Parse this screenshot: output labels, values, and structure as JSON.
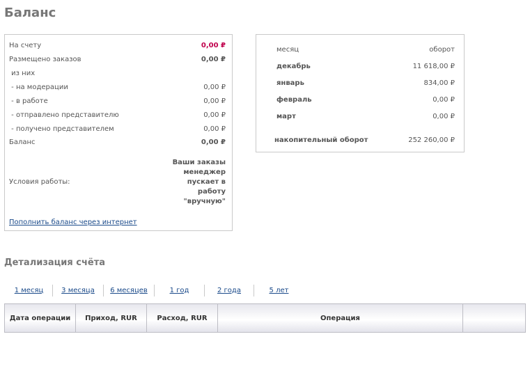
{
  "page": {
    "title": "Баланс"
  },
  "balance": {
    "rows": [
      {
        "label": "На счету",
        "value": "0,00 ₽"
      },
      {
        "label": "Размещено заказов",
        "value": "0,00 ₽"
      },
      {
        "label": " из них",
        "value": ""
      },
      {
        "label": " - на модерации",
        "value": "0,00 ₽"
      },
      {
        "label": " - в работе",
        "value": "0,00 ₽"
      },
      {
        "label": " - отправлено представителю",
        "value": "0,00 ₽"
      },
      {
        "label": " - получено представителем",
        "value": "0,00 ₽"
      },
      {
        "label": "Баланс",
        "value": "0,00 ₽"
      }
    ],
    "conditions_label": "Условия работы:",
    "conditions_value": "Ваши заказы менеджер пускает в работу \"вручную\"",
    "topup_link": "Пополнить баланс через интернет"
  },
  "turnover": {
    "header_month": "месяц",
    "header_turnover": "оборот",
    "months": [
      {
        "name": "декабрь",
        "value": "11 618,00 ₽"
      },
      {
        "name": "январь",
        "value": "834,00 ₽"
      },
      {
        "name": "февраль",
        "value": "0,00 ₽"
      },
      {
        "name": "март",
        "value": "0,00 ₽"
      }
    ],
    "cumulative_label": "накопительный оборот",
    "cumulative_value": "252 260,00 ₽"
  },
  "details": {
    "title": "Детализация счёта",
    "periods": [
      "1 месяц",
      "3 месяца",
      "6 месяцев",
      "1 год",
      "2 года",
      "5 лет"
    ],
    "columns": [
      "Дата операции",
      "Приход, RUR",
      "Расход, RUR",
      "Операция",
      ""
    ]
  },
  "colors": {
    "accent_red": "#c0004c",
    "link": "#1a4a8a"
  }
}
